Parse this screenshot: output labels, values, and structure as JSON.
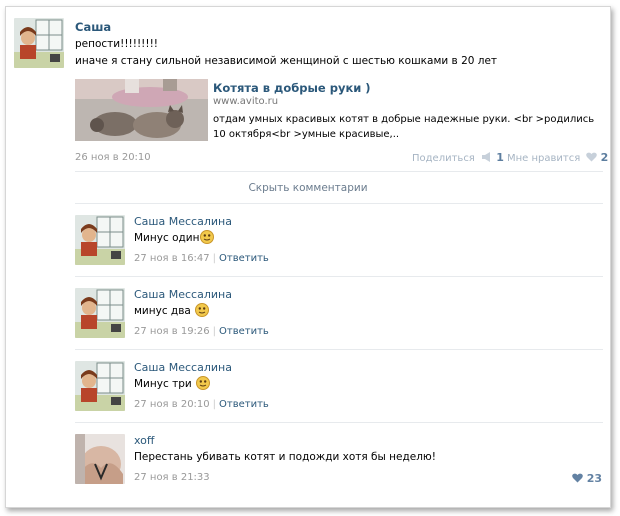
{
  "post": {
    "author": "Саша",
    "lines": [
      "репости!!!!!!!!!",
      "иначе я стану сильной независимой женщиной с шестью кошками в 20 лет"
    ],
    "attachment": {
      "title": "Котята в добрые руки )",
      "url": "www.avito.ru",
      "description": "отдам умных красивых котят в добрые надежные руки. <br >родились 10 октября<br >умные красивые,.."
    },
    "date": "26 ноя в 20:10",
    "share_label": "Поделиться",
    "share_count": "1",
    "like_label": "Мне нравится",
    "like_count": "2"
  },
  "hide_comments_label": "Скрыть комментарии",
  "comments": [
    {
      "author": "Саша Мессалина",
      "text": "Минус один",
      "date": "27 ноя в 16:47",
      "reply": "Ответить"
    },
    {
      "author": "Саша Мессалина",
      "text": "минус два",
      "date": "27 ноя в 19:26",
      "reply": "Ответить"
    },
    {
      "author": "Саша Мессалина",
      "text": "Минус три",
      "date": "27 ноя в 20:10",
      "reply": "Ответить"
    },
    {
      "author": "xoff",
      "text": "Перестань убивать котят и подожди хотя бы неделю!",
      "date": "27 ноя в 21:33",
      "likes": "23"
    }
  ],
  "icons": {
    "share": "megaphone-icon",
    "like": "heart-icon",
    "emoji": "smiley-emoji-icon"
  },
  "colors": {
    "link": "#2b587a",
    "meta": "#999999",
    "like": "#6382a3"
  }
}
